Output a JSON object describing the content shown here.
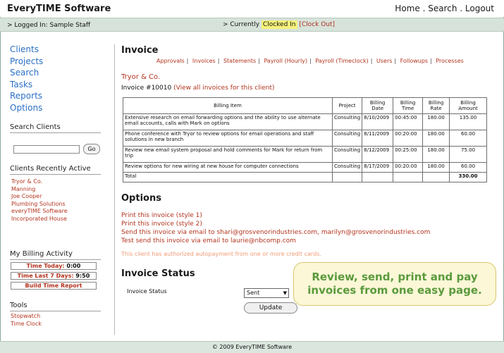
{
  "header": {
    "brand": "EveryTIME Software",
    "nav": [
      "Home",
      "Search",
      "Logout"
    ]
  },
  "status": {
    "logged_in": "> Logged In:  Sample Staff",
    "currently": "> Currently",
    "clocked_in": "Clocked In",
    "clock_out": "[Clock Out]"
  },
  "sidebar": {
    "nav": [
      "Clients",
      "Projects",
      "Search",
      "Tasks",
      "Reports",
      "Options"
    ],
    "search_title": "Search Clients",
    "search_value": "",
    "go_label": "Go",
    "recent_title": "Clients Recently Active",
    "recent": [
      "Tryor & Co.",
      "Manning",
      "Joe Cooper",
      "Plumbing Solutions",
      "everyTIME Software",
      "Incorporated House"
    ],
    "billing_title": "My Billing Activity",
    "time_today_label": "Time Today:",
    "time_today": "0:00",
    "time_7_label": "Time Last 7 Days:",
    "time_7": "9:50",
    "build_report": "Build Time Report",
    "tools_title": "Tools",
    "tools": [
      "Stopwatch",
      "Time Clock"
    ]
  },
  "main": {
    "title": "Invoice",
    "subnav": [
      "Approvals",
      "Invoices",
      "Statements",
      "Payroll (Hourly)",
      "Payroll (Timeclock)",
      "Users",
      "Followups",
      "Processes"
    ],
    "client": "Tryor & Co.",
    "invoice_prefix": "Invoice #10010",
    "invoice_link": "(View all invoices for this client)",
    "table": {
      "headers": [
        "Billing Item",
        "Project",
        "Billing Date",
        "Billing Time",
        "Billing Rate",
        "Billing Amount"
      ],
      "rows": [
        [
          "Extensive research on email forwarding options and the ability to use alternate email accounts, calls with Mark on options",
          "Consulting",
          "8/10/2009",
          "00:45:00",
          "180.00",
          "135.00"
        ],
        [
          "Phone conference with Tryor to review options for email operations and staff solutions in new branch",
          "Consulting",
          "8/11/2009",
          "00:20:00",
          "180.00",
          "60.00"
        ],
        [
          "Review new email system proposal and hold comments for Mark for return from trip",
          "Consulting",
          "8/12/2009",
          "00:25:00",
          "180.00",
          "75.00"
        ],
        [
          "Review options for new wiring at new house for computer connections",
          "Consulting",
          "8/17/2009",
          "00:20:00",
          "180.00",
          "60.00"
        ]
      ],
      "total_label": "Total",
      "total": "330.00"
    },
    "options_title": "Options",
    "options": [
      "Print this invoice (style 1)",
      "Print this invoice (style 2)",
      "Send this invoice via email to shari@grosvenorindustries.com, marilyn@grosvenorindustries.com",
      "Test send this invoice via email to laurie@nbcomp.com"
    ],
    "autopay_note": "This client has authorized autopayment from one or more credit cards.",
    "status_title": "Invoice Status",
    "status_label": "Invoice Status",
    "status_value": "Sent",
    "update_label": "Update"
  },
  "callout": {
    "line1": "Review, send, print and pay",
    "line2": "invoices from one easy page."
  },
  "footer": "© 2009 EveryTIME Software",
  "colors": {
    "link_blue": "#2a6fc6",
    "link_red": "#b3341e",
    "status_bar": "#d7e3da",
    "highlight": "#f6f27a",
    "callout_text": "#5b9a3d"
  }
}
